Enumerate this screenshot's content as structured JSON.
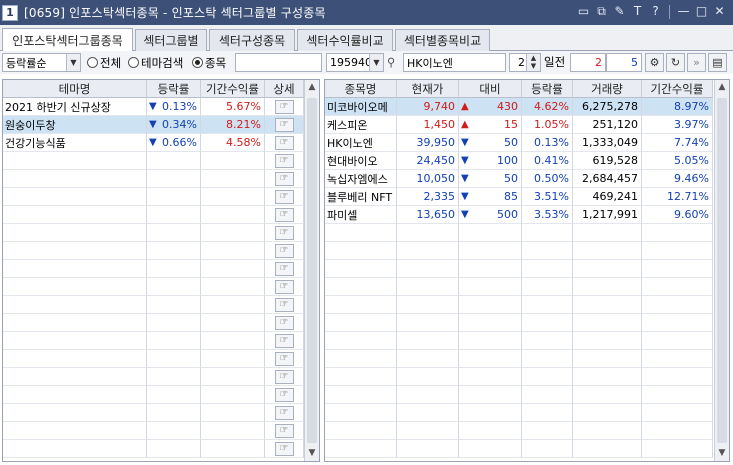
{
  "window": {
    "number": "1",
    "title": "[0659] 인포스탁섹터종목 - 인포스탁 섹터그룹별 구성종목",
    "controls": [
      "▭",
      "⧉",
      "✎",
      "T",
      "?",
      "—",
      "□",
      "✕"
    ]
  },
  "tabs": [
    {
      "label": "인포스탁섹터그룹종목",
      "active": true
    },
    {
      "label": "섹터그룹별",
      "active": false
    },
    {
      "label": "섹터구성종목",
      "active": false
    },
    {
      "label": "섹터수익률비교",
      "active": false
    },
    {
      "label": "섹터별종목비교",
      "active": false
    }
  ],
  "toolbar": {
    "sort_value": "등락률순",
    "radio_all": "전체",
    "radio_theme": "테마검색",
    "radio_stock": "종목",
    "selected_radio": "stock",
    "stock_code": "195940",
    "stock_name": "HK이노엔",
    "period_value": "2",
    "period_label": "일전",
    "range_from": "2",
    "range_to": "5"
  },
  "left_table": {
    "headers": [
      "테마명",
      "등락률",
      "기간수익률",
      "상세"
    ],
    "rows": [
      {
        "name": "2021 하반기 신규상장",
        "change": "0.13%",
        "dir": "down",
        "period": "5.67%",
        "selected": false
      },
      {
        "name": "원숭이두창",
        "change": "0.34%",
        "dir": "down",
        "period": "8.21%",
        "selected": true
      },
      {
        "name": "건강기능식품",
        "change": "0.66%",
        "dir": "down",
        "period": "4.58%",
        "selected": false
      }
    ],
    "detail_icon": "☞",
    "total_rows": 20
  },
  "right_table": {
    "headers": [
      "종목명",
      "현재가",
      "대비",
      "등락률",
      "거래량",
      "기간수익률"
    ],
    "rows": [
      {
        "name": "미코바이오메",
        "price": "9,740",
        "dir": "up",
        "diff": "430",
        "rate": "4.62%",
        "volume": "6,275,278",
        "period": "8.97%",
        "highlight": true
      },
      {
        "name": "케스피온",
        "price": "1,450",
        "dir": "up",
        "diff": "15",
        "rate": "1.05%",
        "volume": "251,120",
        "period": "3.97%",
        "highlight": false
      },
      {
        "name": "HK이노엔",
        "price": "39,950",
        "dir": "down",
        "diff": "50",
        "rate": "0.13%",
        "volume": "1,333,049",
        "period": "7.74%",
        "highlight": false
      },
      {
        "name": "현대바이오",
        "price": "24,450",
        "dir": "down",
        "diff": "100",
        "rate": "0.41%",
        "volume": "619,528",
        "period": "5.05%",
        "highlight": false
      },
      {
        "name": "녹십자엠에스",
        "price": "10,050",
        "dir": "down",
        "diff": "50",
        "rate": "0.50%",
        "volume": "2,684,457",
        "period": "9.46%",
        "highlight": false
      },
      {
        "name": "블루베리 NFT",
        "price": "2,335",
        "dir": "down",
        "diff": "85",
        "rate": "3.51%",
        "volume": "469,241",
        "period": "12.71%",
        "highlight": false
      },
      {
        "name": "파미셀",
        "price": "13,650",
        "dir": "down",
        "diff": "500",
        "rate": "3.53%",
        "volume": "1,217,991",
        "period": "9.60%",
        "highlight": false
      }
    ],
    "total_rows": 20
  },
  "colors": {
    "title_bar": "#3d5078",
    "up": "#d11a1a",
    "down": "#1340b4",
    "selected_row": "#cde3f4"
  }
}
